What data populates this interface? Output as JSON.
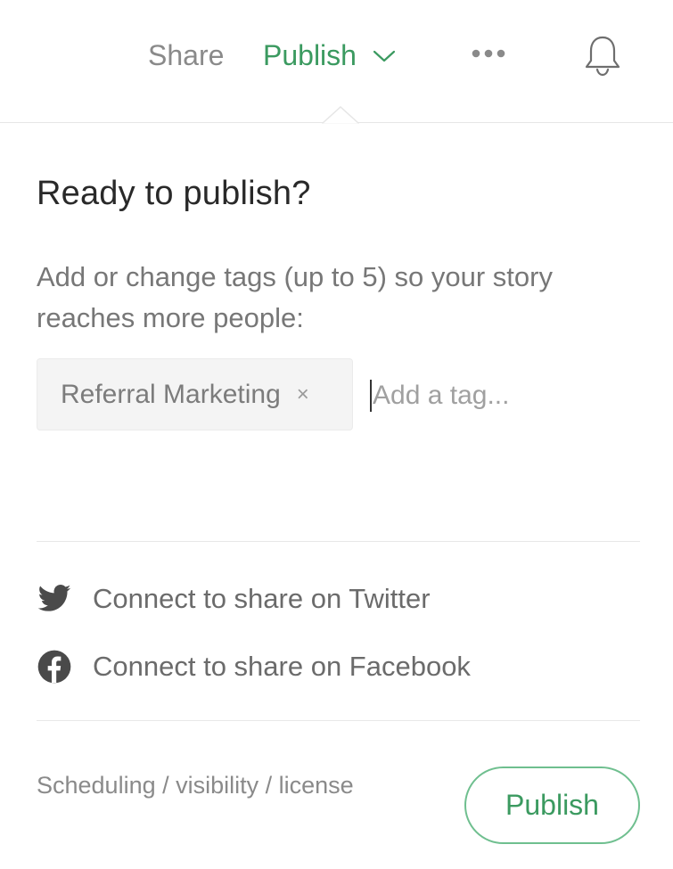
{
  "colors": {
    "accent": "#3b9a60",
    "muted_text": "#8a8a8a",
    "divider": "#e8e8e8"
  },
  "topbar": {
    "share_label": "Share",
    "publish_label": "Publish",
    "more_icon": "more-horizontal-icon",
    "bell_icon": "bell-icon"
  },
  "panel": {
    "title": "Ready to publish?",
    "description": "Add or change tags (up to 5) so your story reaches more people:",
    "tags": [
      {
        "label": "Referral Marketing",
        "remove_symbol": "×"
      }
    ],
    "tag_input": {
      "placeholder": "Add a tag...",
      "value": ""
    },
    "social": [
      {
        "label": "Connect to share on Twitter",
        "icon": "twitter-icon"
      },
      {
        "label": "Connect to share on Facebook",
        "icon": "facebook-icon"
      }
    ],
    "footer_link": "Scheduling / visibility / license",
    "publish_button": "Publish"
  }
}
